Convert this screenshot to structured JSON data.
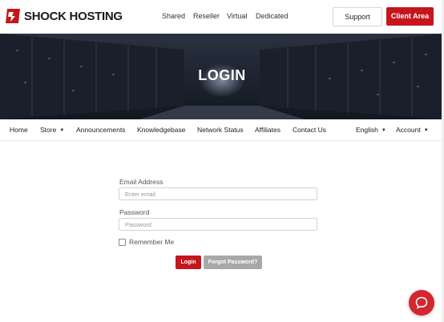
{
  "brand": {
    "name": "SHOCK HOSTING",
    "accent": "#c4161c"
  },
  "top_nav": [
    "Shared",
    "Reseller",
    "Virtual",
    "Dedicated"
  ],
  "header_buttons": {
    "support": "Support",
    "client_area": "Client Area"
  },
  "hero": {
    "title": "LOGIN"
  },
  "sub_nav": {
    "items": [
      "Home",
      "Store",
      "Announcements",
      "Knowledgebase",
      "Network Status",
      "Affiliates",
      "Contact Us"
    ],
    "language": "English",
    "account": "Account"
  },
  "form": {
    "email_label": "Email Address",
    "email_placeholder": "Enter email",
    "email_value": "",
    "password_label": "Password",
    "password_placeholder": "Password",
    "password_value": "",
    "remember_label": "Remember Me",
    "remember_checked": false,
    "login_button": "Login",
    "forgot_button": "Forgot Password?"
  },
  "icons": {
    "chat": "chat-bubble-icon",
    "caret": "caret-down-icon",
    "logo": "shock-logo-icon"
  }
}
